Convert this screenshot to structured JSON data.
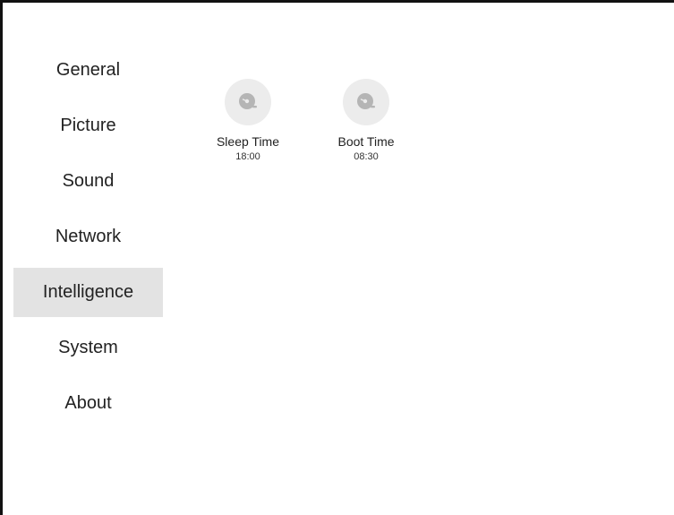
{
  "sidebar": {
    "items": [
      {
        "label": "General",
        "active": false
      },
      {
        "label": "Picture",
        "active": false
      },
      {
        "label": "Sound",
        "active": false
      },
      {
        "label": "Network",
        "active": false
      },
      {
        "label": "Intelligence",
        "active": true
      },
      {
        "label": "System",
        "active": false
      },
      {
        "label": "About",
        "active": false
      }
    ]
  },
  "main": {
    "tiles": [
      {
        "label": "Sleep Time",
        "value": "18:00",
        "icon": "clock-icon"
      },
      {
        "label": "Boot Time",
        "value": "08:30",
        "icon": "clock-icon"
      }
    ]
  },
  "colors": {
    "active_background": "#e3e3e3",
    "icon_background": "#ececec",
    "icon_color": "#b5b5b5",
    "text": "#222222"
  }
}
